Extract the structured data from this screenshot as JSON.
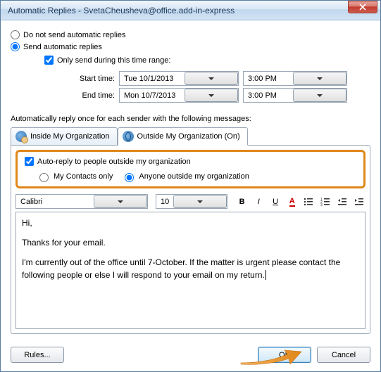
{
  "window": {
    "title": "Automatic Replies - SvetaCheusheva@office.add-in-express"
  },
  "options": {
    "no_send_label": "Do not send automatic replies",
    "send_label": "Send automatic replies",
    "only_range_label": "Only send during this time range:",
    "start_label": "Start time:",
    "end_label": "End time:",
    "start_date": "Tue 10/1/2013",
    "start_time": "3:00 PM",
    "end_date": "Mon 10/7/2013",
    "end_time": "3:00 PM"
  },
  "section_label": "Automatically reply once for each sender with the following messages:",
  "tabs": {
    "inside": "Inside My Organization",
    "outside": "Outside My Organization (On)"
  },
  "outside_panel": {
    "auto_reply_label": "Auto-reply to people outside my organization",
    "contacts_only_label": "My Contacts only",
    "anyone_label": "Anyone outside my organization"
  },
  "toolbar": {
    "font": "Calibri",
    "size": "10"
  },
  "message": {
    "p1": "Hi,",
    "p2": "Thanks for your email.",
    "p3": "I'm currently out of the office until 7-October. If the matter is urgent please contact the following people or else I will respond to your email on my return."
  },
  "buttons": {
    "rules": "Rules...",
    "ok": "OK",
    "cancel": "Cancel"
  }
}
